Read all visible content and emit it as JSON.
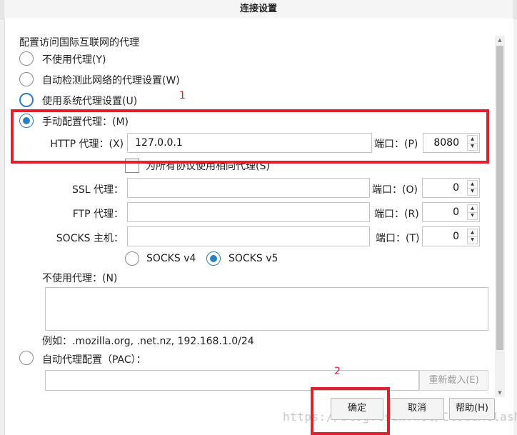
{
  "window": {
    "title": "连接设置"
  },
  "group_title": "配置访问国际互联网的代理",
  "options": {
    "no_proxy": "不使用代理(Y)",
    "auto_detect": "自动检测此网络的代理设置(W)",
    "system": "使用系统代理设置(U)",
    "manual": "手动配置代理：(M)",
    "pac": "自动代理配置（PAC）："
  },
  "http": {
    "label": "HTTP 代理：(X)",
    "value": "127.0.0.1",
    "port_label": "端口：(P)",
    "port": "8080"
  },
  "same_proxy_label": "为所有协议使用相同代理(S)",
  "ssl": {
    "label": "SSL 代理：",
    "port_label": "端口：(O)",
    "port": "0"
  },
  "ftp": {
    "label": "FTP 代理：",
    "port_label": "端口：(R)",
    "port": "0"
  },
  "socks": {
    "label": "SOCKS 主机：",
    "port_label": "端口：(T)",
    "port": "0",
    "v4": "SOCKS v4",
    "v5": "SOCKS v5"
  },
  "no_proxy_for": {
    "label": "不使用代理：(N)",
    "example": "例如：.mozilla.org, .net.nz, 192.168.1.0/24"
  },
  "buttons": {
    "reload": "重新载入(E)",
    "ok": "确定",
    "cancel": "取消",
    "help": "帮助(H)"
  },
  "annotations": {
    "one": "1",
    "two": "2"
  },
  "watermark": "https://blog.csdn.net/CloudAtlasM",
  "colors": {
    "accent": "#2b7fc1",
    "highlight": "#e0202e"
  }
}
